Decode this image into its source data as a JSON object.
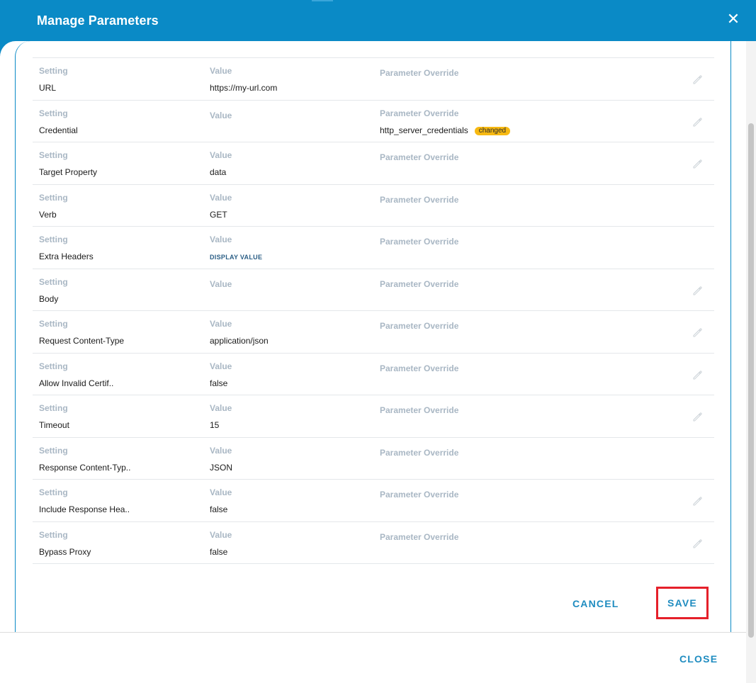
{
  "dialog": {
    "title": "Manage Parameters",
    "close_icon": "close-icon"
  },
  "columns": {
    "setting": "Setting",
    "value": "Value",
    "override": "Parameter Override"
  },
  "rows": [
    {
      "setting": "URL",
      "value": "https://my-url.com",
      "override": "",
      "badge": "",
      "editable": true
    },
    {
      "setting": "Credential",
      "value": "",
      "override": "http_server_credentials",
      "badge": "changed",
      "editable": true
    },
    {
      "setting": "Target Property",
      "value": "data",
      "override": "",
      "badge": "",
      "editable": true
    },
    {
      "setting": "Verb",
      "value": "GET",
      "override": "",
      "badge": "",
      "editable": false
    },
    {
      "setting": "Extra Headers",
      "value": "DISPLAY VALUE",
      "override": "",
      "badge": "",
      "editable": false
    },
    {
      "setting": "Body",
      "value": "",
      "override": "",
      "badge": "",
      "editable": true
    },
    {
      "setting": "Request Content-Type",
      "value": "application/json",
      "override": "",
      "badge": "",
      "editable": true
    },
    {
      "setting": "Allow Invalid Certif..",
      "value": "false",
      "override": "",
      "badge": "",
      "editable": true
    },
    {
      "setting": "Timeout",
      "value": "15",
      "override": "",
      "badge": "",
      "editable": true
    },
    {
      "setting": "Response Content-Typ..",
      "value": "JSON",
      "override": "",
      "badge": "",
      "editable": false
    },
    {
      "setting": "Include Response Hea..",
      "value": "false",
      "override": "",
      "badge": "",
      "editable": true
    },
    {
      "setting": "Bypass Proxy",
      "value": "false",
      "override": "",
      "badge": "",
      "editable": true
    }
  ],
  "actions": {
    "cancel": "CANCEL",
    "save": "SAVE",
    "close": "CLOSE"
  },
  "colors": {
    "header": "#0a8ac6",
    "badge": "#f7b912",
    "accent_button": "#1f8cc0",
    "highlight": "#e5202a"
  }
}
